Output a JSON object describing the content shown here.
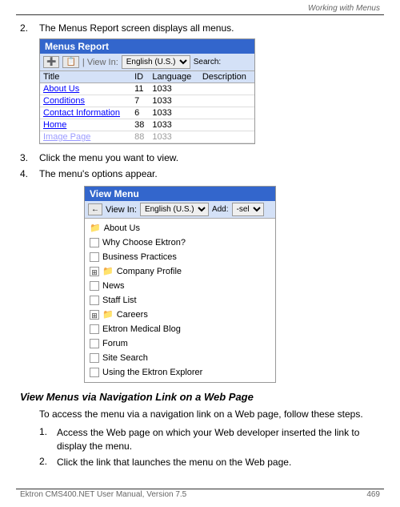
{
  "header": {
    "text": "Working with Menus"
  },
  "footer": {
    "left": "Ektron CMS400.NET User Manual, Version 7.5",
    "right": "469"
  },
  "step2": {
    "number": "2.",
    "text": "The Menus Report screen displays all menus."
  },
  "menus_report": {
    "title": "Menus Report",
    "toolbar": {
      "add_icon": "➕",
      "view_in_label": "| View In:",
      "view_in_value": "English (U.S.)",
      "search_label": "Search:"
    },
    "table": {
      "columns": [
        "Title",
        "ID",
        "Language",
        "Description"
      ],
      "rows": [
        {
          "title": "About Us",
          "id": "11",
          "language": "1033",
          "description": ""
        },
        {
          "title": "Conditions",
          "id": "7",
          "language": "1033",
          "description": ""
        },
        {
          "title": "Contact Information",
          "id": "6",
          "language": "1033",
          "description": ""
        },
        {
          "title": "Home",
          "id": "38",
          "language": "1033",
          "description": ""
        },
        {
          "title": "Image Page",
          "id": "88",
          "language": "1033",
          "description": ""
        }
      ]
    }
  },
  "step3": {
    "number": "3.",
    "text": "Click the menu you want to view."
  },
  "step4": {
    "number": "4.",
    "text": "The menu's options appear."
  },
  "view_menu": {
    "title": "View Menu",
    "toolbar": {
      "back_label": "←",
      "view_in_label": "View In:",
      "view_in_value": "English (U.S.)",
      "add_label": "Add:",
      "add_value": "-sele"
    },
    "items": [
      {
        "label": "About Us",
        "icon": "folder",
        "has_plus": false
      },
      {
        "label": "Why Choose Ektron?",
        "icon": "checkbox",
        "has_plus": false
      },
      {
        "label": "Business Practices",
        "icon": "checkbox",
        "has_plus": false
      },
      {
        "label": "Company Profile",
        "icon": "folder",
        "has_plus": true
      },
      {
        "label": "News",
        "icon": "checkbox",
        "has_plus": false
      },
      {
        "label": "Staff List",
        "icon": "checkbox",
        "has_plus": false
      },
      {
        "label": "Careers",
        "icon": "folder",
        "has_plus": true
      },
      {
        "label": "Ektron Medical Blog",
        "icon": "checkbox",
        "has_plus": false
      },
      {
        "label": "Forum",
        "icon": "checkbox",
        "has_plus": false
      },
      {
        "label": "Site Search",
        "icon": "checkbox",
        "has_plus": false
      },
      {
        "label": "Using the Ektron Explorer",
        "icon": "checkbox",
        "has_plus": false
      }
    ]
  },
  "section_heading": "View Menus via Navigation Link on a Web Page",
  "section_intro": "To access the menu via a navigation link on a Web page, follow these steps.",
  "sub_steps": [
    {
      "number": "1.",
      "text": "Access the Web page on which your Web developer inserted the link to display the menu."
    },
    {
      "number": "2.",
      "text": "Click the link that launches the menu on the Web page."
    }
  ]
}
